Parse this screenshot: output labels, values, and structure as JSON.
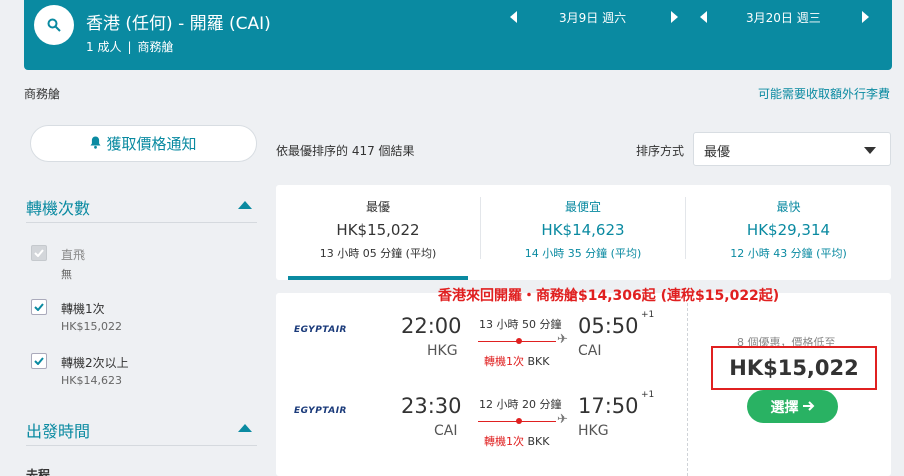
{
  "header": {
    "route": "香港 (任何) - 開羅 (CAI)",
    "passengers": "1 成人",
    "cabin": "商務艙",
    "depart_date": "3月9日 週六",
    "return_date": "3月20日 週三"
  },
  "cabin_label": "商務艙",
  "fee_link": "可能需要收取額外行李費",
  "price_alert": "獲取價格通知",
  "results_count": "依最優排序的 417 個結果",
  "sort": {
    "label": "排序方式",
    "value": "最優"
  },
  "filters": {
    "stops_title": "轉機次數",
    "stops": [
      {
        "label": "直飛",
        "sub": "無",
        "checked": true,
        "disabled": true
      },
      {
        "label": "轉機1次",
        "sub": "HK$15,022",
        "checked": true,
        "disabled": false
      },
      {
        "label": "轉機2次以上",
        "sub": "HK$14,623",
        "checked": true,
        "disabled": false
      }
    ],
    "departure_title": "出發時間",
    "departure_next": "去程"
  },
  "tabs": [
    {
      "title": "最優",
      "price": "HK$15,022",
      "duration": "13 小時 05 分鐘 (平均)"
    },
    {
      "title": "最便宜",
      "price": "HK$14,623",
      "duration": "14 小時 35 分鐘 (平均)"
    },
    {
      "title": "最快",
      "price": "HK$29,314",
      "duration": "12 小時 43 分鐘 (平均)"
    }
  ],
  "promo": "香港來回開羅・商務艙$14,306起 (連稅$15,022起)",
  "flight": {
    "airline": "EGYPTAIR",
    "outbound": {
      "depart_time": "22:00",
      "depart_airport": "HKG",
      "arrive_time": "05:50",
      "arrive_airport": "CAI",
      "day_offset": "+1",
      "duration": "13 小時 50 分鐘",
      "stops": "轉機1次",
      "via": "BKK"
    },
    "inbound": {
      "depart_time": "23:30",
      "depart_airport": "CAI",
      "arrive_time": "17:50",
      "arrive_airport": "HKG",
      "day_offset": "+1",
      "duration": "12 小時 20 分鐘",
      "stops": "轉機1次",
      "via": "BKK"
    },
    "deals": "8 個優惠，價格低至",
    "price": "HK$15,022",
    "select_label": "選擇"
  },
  "colors": {
    "accent": "#0a8aa1",
    "highlight": "#e02020",
    "select": "#29b263"
  }
}
